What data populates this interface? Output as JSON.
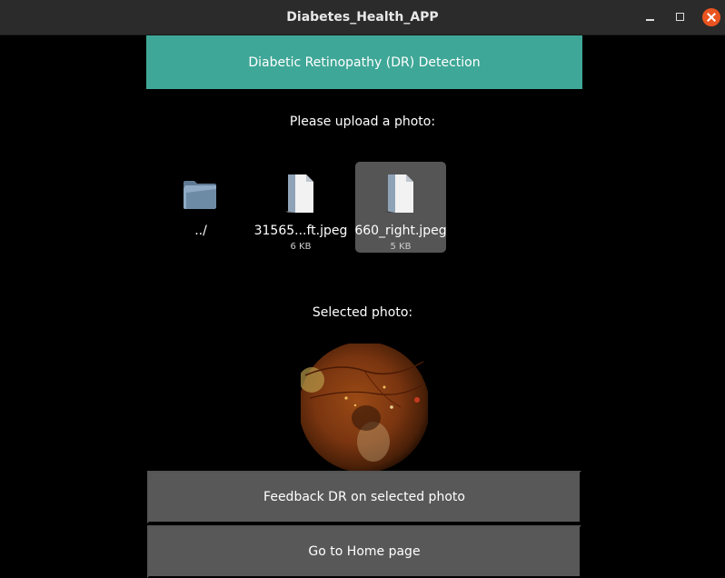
{
  "window": {
    "title": "Diabetes_Health_APP"
  },
  "header": {
    "title": "Diabetic Retinopathy (DR) Detection"
  },
  "upload": {
    "label": "Please upload a photo:",
    "files": [
      {
        "name": "../",
        "size": "",
        "type": "folder"
      },
      {
        "name": "31565...ft.jpeg",
        "size": "6 KB",
        "type": "file"
      },
      {
        "name": "660_right.jpeg",
        "size": "5 KB",
        "type": "file",
        "selected": true
      }
    ]
  },
  "selected": {
    "label": "Selected photo:"
  },
  "buttons": {
    "feedback": "Feedback DR on selected photo",
    "home": "Go to Home page"
  },
  "colors": {
    "accent": "#3fa797",
    "button": "#585858",
    "selected_item": "#555555",
    "close": "#e95420"
  }
}
